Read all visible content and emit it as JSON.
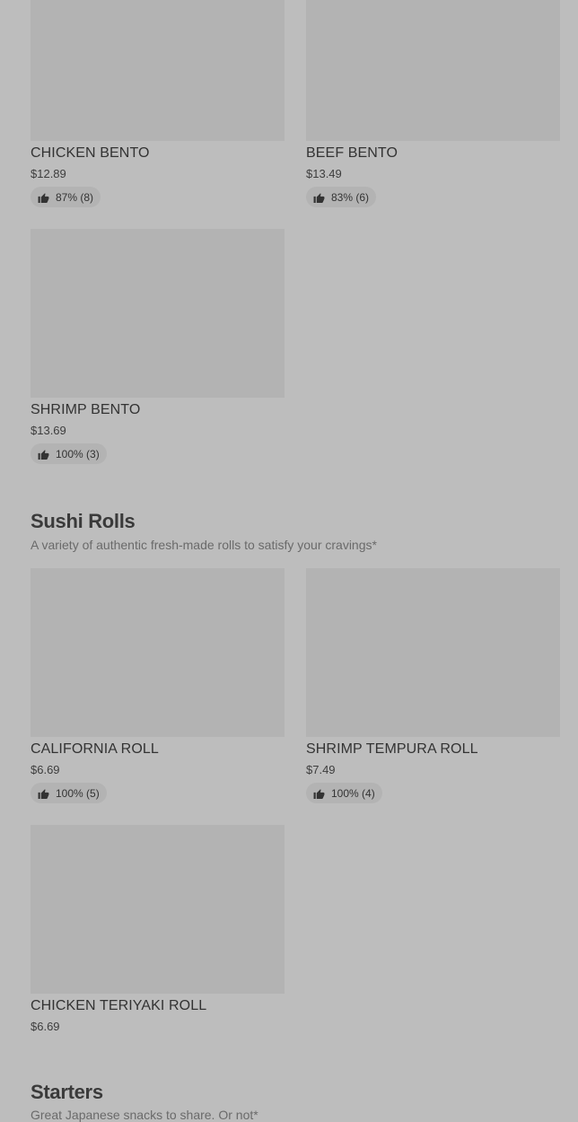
{
  "sections": [
    {
      "items": [
        {
          "name": "CHICKEN BENTO",
          "price": "$12.89",
          "rating": "87% (8)"
        },
        {
          "name": "BEEF BENTO",
          "price": "$13.49",
          "rating": "83% (6)"
        },
        {
          "name": "SHRIMP BENTO",
          "price": "$13.69",
          "rating": "100% (3)"
        }
      ]
    },
    {
      "title": "Sushi Rolls",
      "description": "A variety of authentic fresh-made rolls to satisfy your cravings*",
      "items": [
        {
          "name": "CALIFORNIA ROLL",
          "price": "$6.69",
          "rating": "100% (5)"
        },
        {
          "name": "SHRIMP TEMPURA ROLL",
          "price": "$7.49",
          "rating": "100% (4)"
        },
        {
          "name": "CHICKEN TERIYAKI ROLL",
          "price": "$6.69"
        }
      ]
    },
    {
      "title": "Starters",
      "description": "Great Japanese snacks to share. Or not*"
    }
  ],
  "icons": {
    "rating": "thumbs-up-icon"
  },
  "colors": {
    "background": "#bdbdbd",
    "placeholder": "#b3b3b3",
    "text": "#333333"
  }
}
